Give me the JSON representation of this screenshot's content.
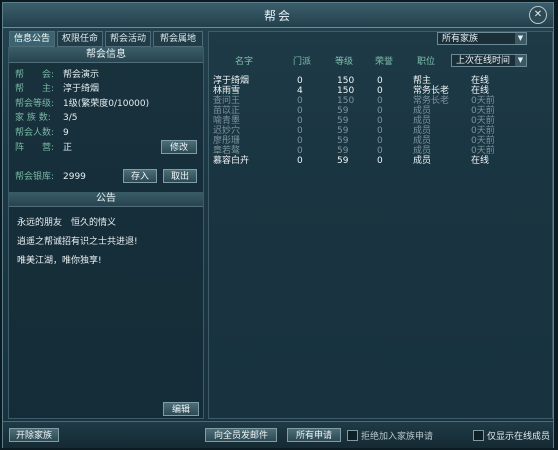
{
  "window": {
    "title": "帮会",
    "close_glyph": "✕"
  },
  "tabs": [
    {
      "label": "信息公告",
      "active": true
    },
    {
      "label": "权限任命",
      "active": false
    },
    {
      "label": "帮会活动",
      "active": false
    },
    {
      "label": "帮会属地",
      "active": false
    }
  ],
  "info": {
    "header": "帮会信息",
    "rows": [
      {
        "label": "帮　　会:",
        "value": "帮会演示"
      },
      {
        "label": "帮　　主:",
        "value": "淳于绮烟"
      },
      {
        "label": "帮会等级:",
        "value": "1级(繁荣度0/10000)"
      },
      {
        "label": "家 族 数:",
        "value": "3/5"
      },
      {
        "label": "帮会人数:",
        "value": "9"
      },
      {
        "label": "阵　　营:",
        "value": "正"
      }
    ],
    "modify_button": "修改",
    "treasury_label": "帮会银库:",
    "treasury_value": "2999",
    "deposit_button": "存入",
    "withdraw_button": "取出"
  },
  "notice": {
    "header": "公告",
    "lines": [
      "永远的朋友　恒久的情义",
      "逍遥之帮诚招有识之士共进退!",
      "唯美江湖，唯你独享!"
    ],
    "edit_button": "编辑"
  },
  "filter": {
    "family_select": "所有家族",
    "sort_select": "上次在线时间"
  },
  "table": {
    "columns": [
      "名字",
      "门派",
      "等级",
      "荣誉",
      "职位"
    ],
    "rows": [
      {
        "name": "淳于绮烟",
        "sect": "0",
        "level": "150",
        "honor": "0",
        "position": "帮主",
        "status": "在线",
        "online": true
      },
      {
        "name": "林雨雪",
        "sect": "4",
        "level": "150",
        "honor": "0",
        "position": "常务长老",
        "status": "在线",
        "online": true
      },
      {
        "name": "查问王",
        "sect": "0",
        "level": "150",
        "honor": "0",
        "position": "常务长老",
        "status": "0天前",
        "online": false
      },
      {
        "name": "苗苡正",
        "sect": "0",
        "level": "59",
        "honor": "0",
        "position": "成员",
        "status": "0天前",
        "online": false
      },
      {
        "name": "喻青墨",
        "sect": "0",
        "level": "59",
        "honor": "0",
        "position": "成员",
        "status": "0天前",
        "online": false
      },
      {
        "name": "迟妙穴",
        "sect": "0",
        "level": "59",
        "honor": "0",
        "position": "成员",
        "status": "0天前",
        "online": false
      },
      {
        "name": "廖彤珊",
        "sect": "0",
        "level": "59",
        "honor": "0",
        "position": "成员",
        "status": "0天前",
        "online": false
      },
      {
        "name": "章若骜",
        "sect": "0",
        "level": "59",
        "honor": "0",
        "position": "成员",
        "status": "0天前",
        "online": false
      },
      {
        "name": "慕容白卉",
        "sect": "0",
        "level": "59",
        "honor": "0",
        "position": "成员",
        "status": "在线",
        "online": true
      }
    ]
  },
  "bottom": {
    "found_family_button": "开除家族",
    "mail_all_button": "向全员发邮件",
    "applications_button": "所有申请",
    "auto_reject_label": "拒绝加入家族申请",
    "online_only_label": "仅显示在线成员"
  },
  "colors": {
    "online": "#f2f6f7",
    "offline": "#7d949c",
    "label_green": "#78b7a5"
  }
}
